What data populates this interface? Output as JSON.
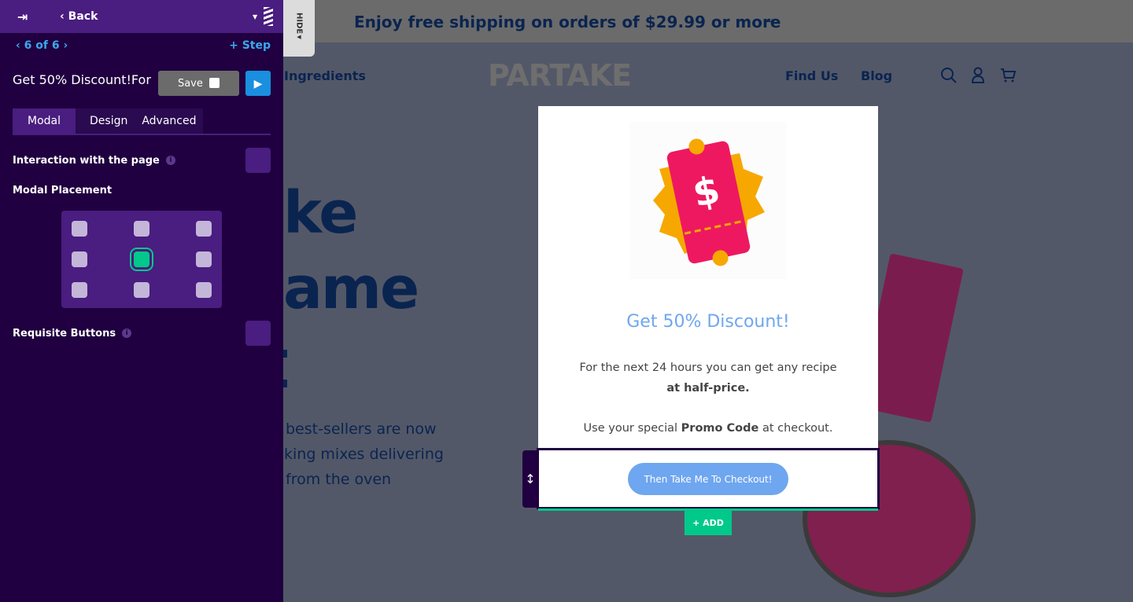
{
  "editor": {
    "back_label": "Back",
    "step_counter": "6 of 6",
    "add_step_label": "Step",
    "title": "Get 50% Discount!For",
    "save_label": "Save",
    "tabs": [
      {
        "label": "Modal",
        "active": true
      },
      {
        "label": "Design",
        "active": false
      },
      {
        "label": "Advanced",
        "active": false
      }
    ],
    "settings": {
      "interaction_label": "Interaction with the page",
      "placement_label": "Modal Placement",
      "placement_selected": "center",
      "requisite_label": "Requisite Buttons"
    },
    "hide_label": "HIDE",
    "add_label": "+ ADD",
    "colors": {
      "panel": "#200040",
      "accent": "#4a1d80",
      "selected": "#00c98a",
      "play": "#1a8fe0"
    }
  },
  "site": {
    "banner": "Enjoy free shipping on orders of $29.99 or more",
    "banner_arrow": "→",
    "nav_left": "Ingredients",
    "logo": "PARTAKE",
    "nav_right": [
      "Find Us",
      "Blog"
    ],
    "hero_lines": [
      "ke",
      "ame",
      "t"
    ],
    "hero_sub": [
      "best-sellers are now",
      "king mixes delivering",
      "from the oven"
    ]
  },
  "modal": {
    "heading": "Get 50% Discount!",
    "line1": "For the next 24 hours you can get any recipe",
    "line2": "at half-price.",
    "line3_pre": "Use your special ",
    "line3_bold": "Promo Code",
    "line3_post": " at checkout.",
    "cta": "Then Take Me To Checkout!",
    "colors": {
      "heading": "#6fa6f0",
      "cta": "#6fa6f0"
    }
  }
}
